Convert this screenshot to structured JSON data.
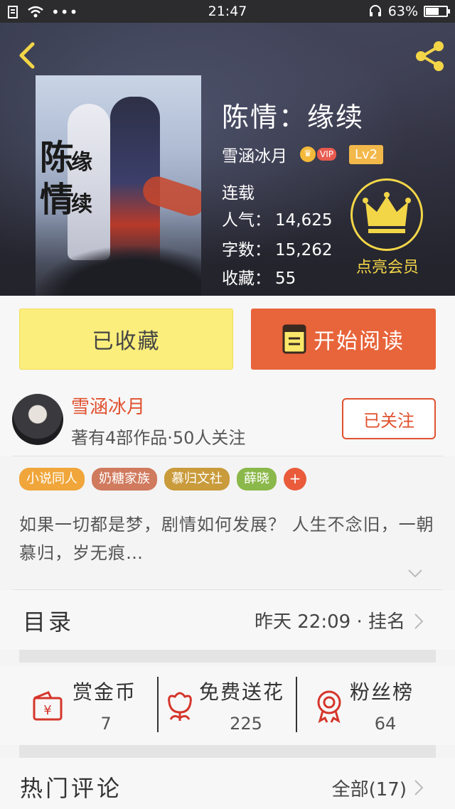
{
  "status_bar": {
    "time": "21:47",
    "battery": "63%",
    "battery_level": 0.63
  },
  "book": {
    "title": "陈情：缘续",
    "author": "雪涵冰月",
    "vip_text": "VIP",
    "level": "Lv2",
    "status": "连载",
    "popularity_label": "人气：",
    "popularity": "14,625",
    "words_label": "字数：",
    "words": "15,262",
    "favorites_label": "收藏：",
    "favorites": "55",
    "cover_text": {
      "line1": "陈",
      "line1b": "缘",
      "line2": "情",
      "line2b": "续"
    }
  },
  "vip_promo": {
    "label": "点亮会员"
  },
  "actions": {
    "collected_label": "已收藏",
    "read_label": "开始阅读"
  },
  "author_card": {
    "name": "雪涵冰月",
    "meta": "著有4部作品·50人关注",
    "follow_label": "已关注"
  },
  "tags": [
    {
      "label": "小说同人"
    },
    {
      "label": "奶糖家族"
    },
    {
      "label": "慕归文社"
    },
    {
      "label": "薛晓"
    }
  ],
  "tags_add": "+",
  "synopsis": "如果一切都是梦，剧情如何发展？ 人生不念旧，一朝慕归，岁无痕…",
  "catalog": {
    "title": "目录",
    "info": "昨天 22:09 · 挂名"
  },
  "rewards": [
    {
      "label": "赏金币",
      "count": "7",
      "icon": "red-envelope-icon"
    },
    {
      "label": "免费送花",
      "count": "225",
      "icon": "flower-icon"
    },
    {
      "label": "粉丝榜",
      "count": "64",
      "icon": "medal-icon"
    }
  ],
  "comments": {
    "title": "热门评论",
    "all_label": "全部(17)"
  },
  "colors": {
    "accent": "#e8643a",
    "author_red": "#e0512e",
    "collected_yellow": "#fbee7c",
    "vip_gold": "#f3d648"
  }
}
